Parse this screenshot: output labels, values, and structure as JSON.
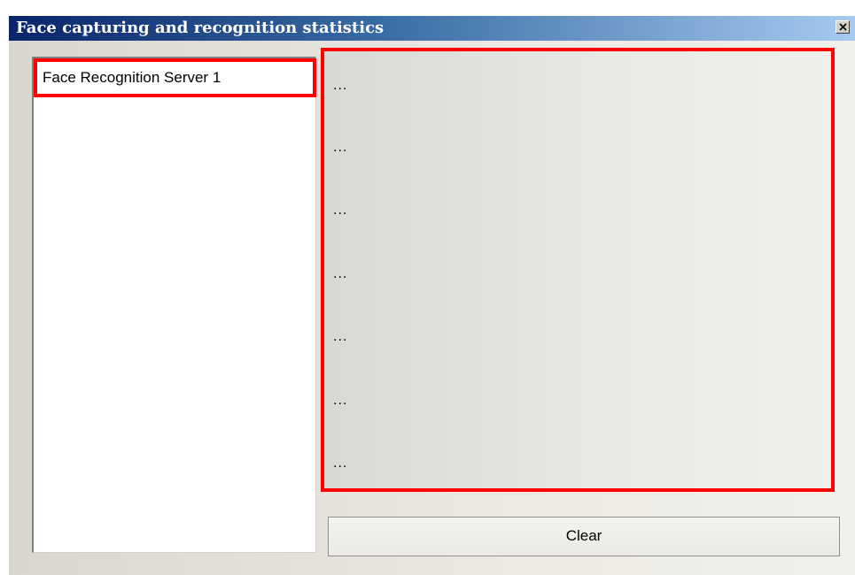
{
  "window": {
    "title": "Face capturing and recognition statistics",
    "close_icon": "close-icon"
  },
  "server_list": {
    "items": [
      {
        "label": "Face Recognition Server 1"
      }
    ]
  },
  "stats": {
    "lines": [
      "...",
      "...",
      "...",
      "...",
      "...",
      "...",
      "..."
    ]
  },
  "actions": {
    "clear_label": "Clear"
  },
  "colors": {
    "titlebar_start": "#0a246a",
    "titlebar_end": "#a6caf0",
    "highlight": "#ff0000"
  }
}
